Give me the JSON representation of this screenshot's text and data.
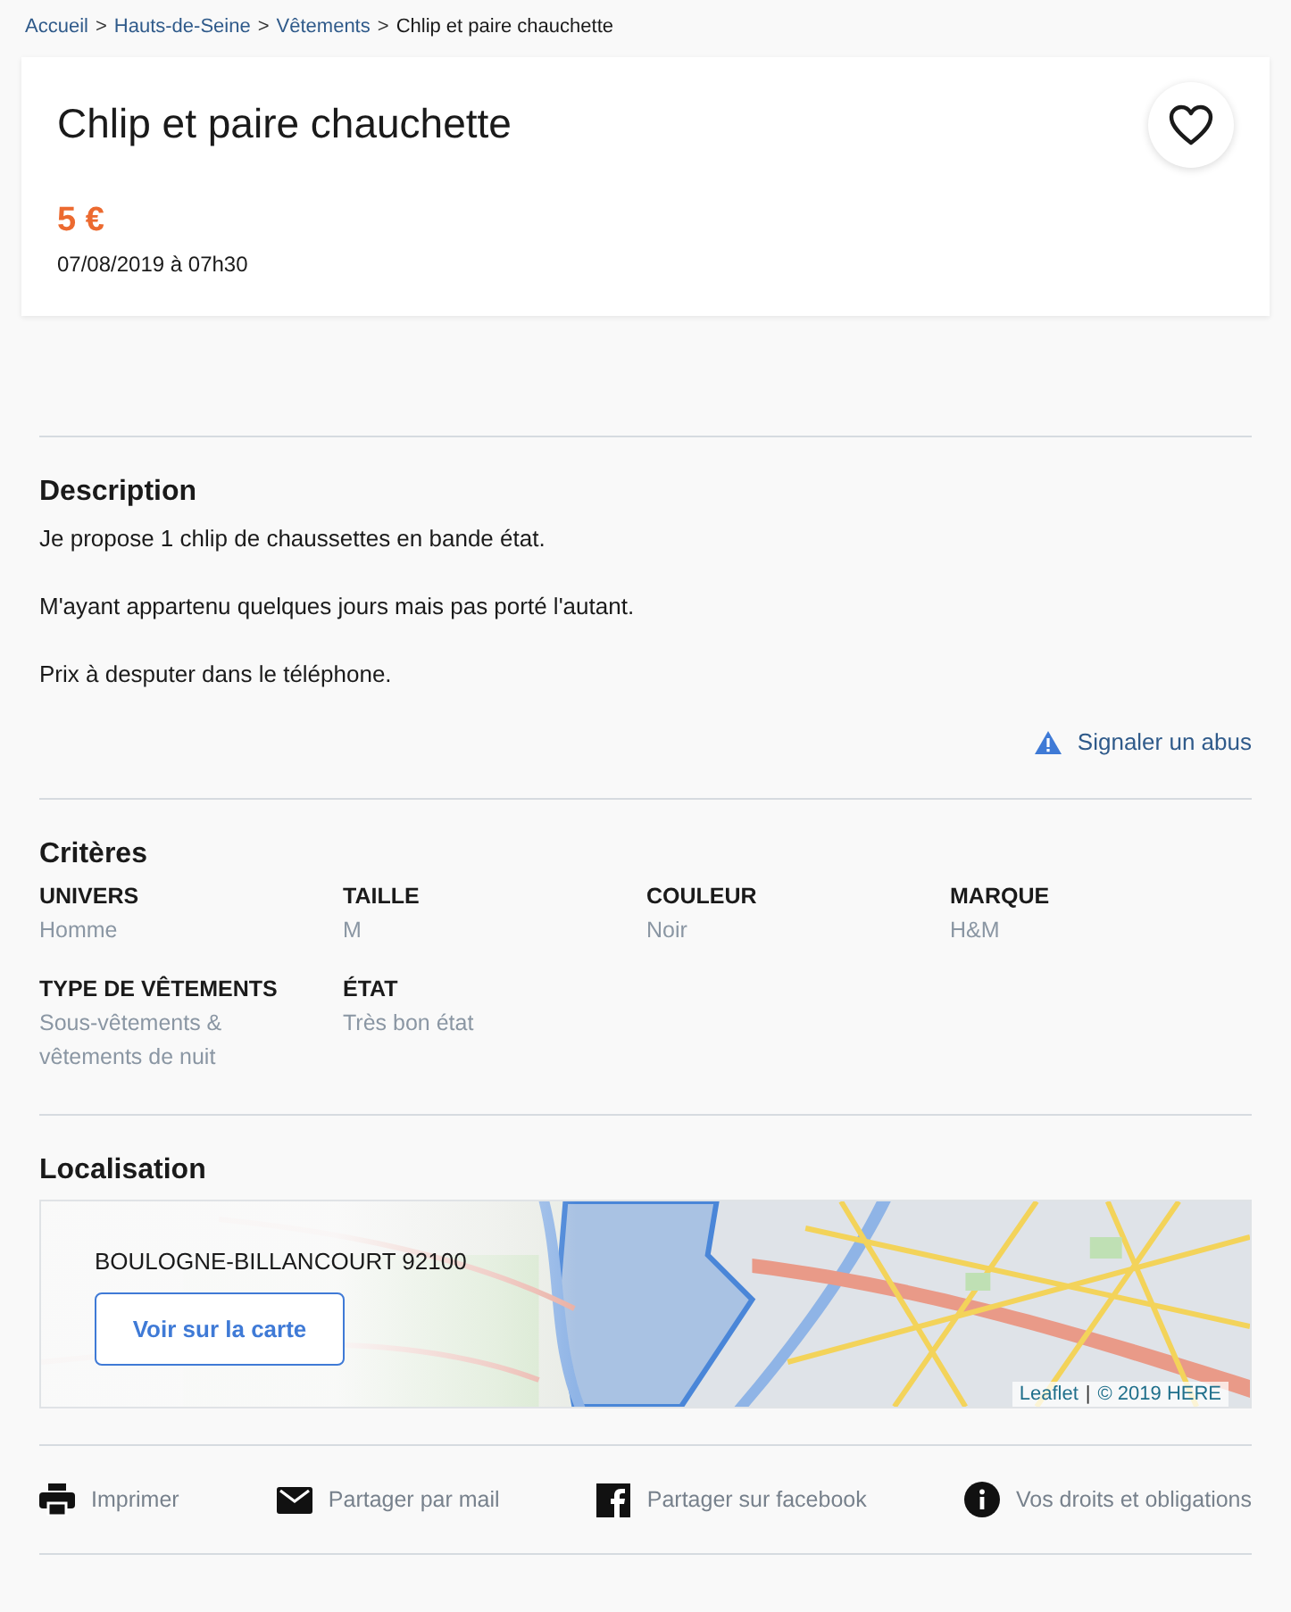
{
  "breadcrumb": [
    {
      "label": "Accueil",
      "link": true
    },
    {
      "label": "Hauts-de-Seine",
      "link": true
    },
    {
      "label": "Vêtements",
      "link": true
    },
    {
      "label": "Chlip et paire chauchette",
      "link": false
    }
  ],
  "breadcrumb_separator": ">",
  "ad": {
    "title": "Chlip et paire chauchette",
    "price": "5 €",
    "date": "07/08/2019 à 07h30"
  },
  "description": {
    "heading": "Description",
    "paragraphs": [
      "Je propose 1 chlip de chaussettes en bande état.",
      "M'ayant appartenu quelques jours mais pas porté l'autant.",
      "Prix à desputer dans le téléphone."
    ],
    "report_link": "Signaler un abus"
  },
  "criteria": {
    "heading": "Critères",
    "items": [
      {
        "label": "UNIVERS",
        "value": "Homme"
      },
      {
        "label": "TAILLE",
        "value": "M"
      },
      {
        "label": "COULEUR",
        "value": "Noir"
      },
      {
        "label": "MARQUE",
        "value": "H&M"
      },
      {
        "label": "TYPE DE VÊTEMENTS",
        "value": "Sous-vêtements & vêtements de nuit"
      },
      {
        "label": "ÉTAT",
        "value": "Très bon état"
      }
    ]
  },
  "location": {
    "heading": "Localisation",
    "address": "BOULOGNE-BILLANCOURT 92100",
    "button": "Voir sur la carte",
    "attribution": [
      {
        "label": "Leaflet"
      },
      {
        "label": "© 2019 HERE"
      }
    ],
    "attribution_separator": "|"
  },
  "actions": [
    {
      "kind": "print",
      "label": "Imprimer"
    },
    {
      "kind": "mail",
      "label": "Partager par mail"
    },
    {
      "kind": "facebook",
      "label": "Partager sur facebook"
    },
    {
      "kind": "info",
      "label": "Vos droits et obligations"
    }
  ]
}
